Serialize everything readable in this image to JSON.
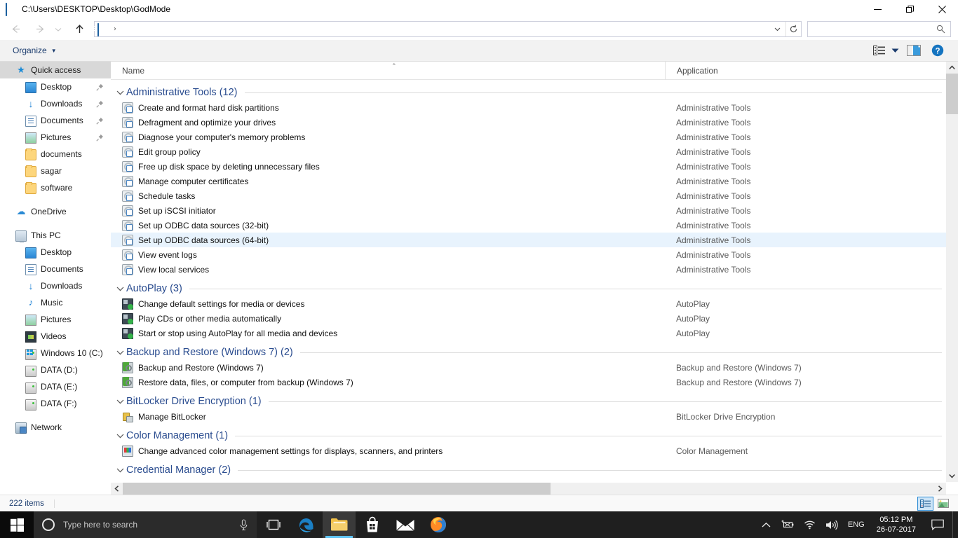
{
  "window": {
    "title": "C:\\Users\\DESKTOP\\Desktop\\GodMode",
    "minimize_label": "Minimize",
    "restore_label": "Restore",
    "close_label": "Close"
  },
  "nav": {
    "back_label": "Back",
    "forward_label": "Forward",
    "recent_label": "Recent locations",
    "up_label": "Up",
    "address_separator": "›",
    "address_chevron": "⌄",
    "refresh_label": "Refresh"
  },
  "search": {
    "placeholder": "",
    "value": "",
    "icon": "search-icon"
  },
  "command_bar": {
    "organize_label": "Organize",
    "organize_caret": "▼",
    "view_caret": "▼",
    "view_label": "Change your view",
    "preview_label": "Show the preview pane",
    "help_label": "Help"
  },
  "sidebar": {
    "items": [
      {
        "label": "Quick access",
        "icon": "star-icon",
        "level": 0,
        "selected": true,
        "pinned": false
      },
      {
        "label": "Desktop",
        "icon": "desktop-icon",
        "level": 1,
        "selected": false,
        "pinned": true
      },
      {
        "label": "Downloads",
        "icon": "download-icon",
        "level": 1,
        "selected": false,
        "pinned": true
      },
      {
        "label": "Documents",
        "icon": "documents-icon",
        "level": 1,
        "selected": false,
        "pinned": true
      },
      {
        "label": "Pictures",
        "icon": "pictures-icon",
        "level": 1,
        "selected": false,
        "pinned": true
      },
      {
        "label": "documents",
        "icon": "folder-icon",
        "level": 1,
        "selected": false,
        "pinned": false
      },
      {
        "label": "sagar",
        "icon": "folder-icon",
        "level": 1,
        "selected": false,
        "pinned": false
      },
      {
        "label": "software",
        "icon": "folder-icon",
        "level": 1,
        "selected": false,
        "pinned": false
      },
      {
        "label": "OneDrive",
        "icon": "onedrive-cloud-icon",
        "level": 0,
        "selected": false,
        "pinned": false,
        "gap_before": true
      },
      {
        "label": "This PC",
        "icon": "this-pc-icon",
        "level": 0,
        "selected": false,
        "pinned": false,
        "gap_before": true
      },
      {
        "label": "Desktop",
        "icon": "desktop-icon",
        "level": 1,
        "selected": false,
        "pinned": false
      },
      {
        "label": "Documents",
        "icon": "documents-icon",
        "level": 1,
        "selected": false,
        "pinned": false
      },
      {
        "label": "Downloads",
        "icon": "download-icon",
        "level": 1,
        "selected": false,
        "pinned": false
      },
      {
        "label": "Music",
        "icon": "music-note-icon",
        "level": 1,
        "selected": false,
        "pinned": false
      },
      {
        "label": "Pictures",
        "icon": "pictures-icon",
        "level": 1,
        "selected": false,
        "pinned": false
      },
      {
        "label": "Videos",
        "icon": "videos-icon",
        "level": 1,
        "selected": false,
        "pinned": false
      },
      {
        "label": "Windows 10 (C:)",
        "icon": "windows-drive-icon",
        "level": 1,
        "selected": false,
        "pinned": false
      },
      {
        "label": "DATA (D:)",
        "icon": "drive-icon",
        "level": 1,
        "selected": false,
        "pinned": false
      },
      {
        "label": "DATA (E:)",
        "icon": "drive-icon",
        "level": 1,
        "selected": false,
        "pinned": false
      },
      {
        "label": "DATA (F:)",
        "icon": "drive-icon",
        "level": 1,
        "selected": false,
        "pinned": false
      },
      {
        "label": "Network",
        "icon": "network-icon",
        "level": 0,
        "selected": false,
        "pinned": false,
        "gap_before": true
      }
    ],
    "pin_glyph": "📌"
  },
  "columns": {
    "name": "Name",
    "application": "Application",
    "sort_arrow": "⌃"
  },
  "groups": [
    {
      "title": "Administrative Tools (12)",
      "chevron": "⌄",
      "icon": "administrative-tools-icon",
      "rows": [
        {
          "name": "Create and format hard disk partitions",
          "app": "Administrative Tools",
          "selected": false
        },
        {
          "name": "Defragment and optimize your drives",
          "app": "Administrative Tools",
          "selected": false
        },
        {
          "name": "Diagnose your computer's memory problems",
          "app": "Administrative Tools",
          "selected": false
        },
        {
          "name": "Edit group policy",
          "app": "Administrative Tools",
          "selected": false
        },
        {
          "name": "Free up disk space by deleting unnecessary files",
          "app": "Administrative Tools",
          "selected": false
        },
        {
          "name": "Manage computer certificates",
          "app": "Administrative Tools",
          "selected": false
        },
        {
          "name": "Schedule tasks",
          "app": "Administrative Tools",
          "selected": false
        },
        {
          "name": "Set up iSCSI initiator",
          "app": "Administrative Tools",
          "selected": false
        },
        {
          "name": "Set up ODBC data sources (32-bit)",
          "app": "Administrative Tools",
          "selected": false
        },
        {
          "name": "Set up ODBC data sources (64-bit)",
          "app": "Administrative Tools",
          "selected": true
        },
        {
          "name": "View event logs",
          "app": "Administrative Tools",
          "selected": false
        },
        {
          "name": "View local services",
          "app": "Administrative Tools",
          "selected": false
        }
      ]
    },
    {
      "title": "AutoPlay (3)",
      "chevron": "⌄",
      "icon": "autoplay-icon",
      "rows": [
        {
          "name": "Change default settings for media or devices",
          "app": "AutoPlay",
          "selected": false
        },
        {
          "name": "Play CDs or other media automatically",
          "app": "AutoPlay",
          "selected": false
        },
        {
          "name": "Start or stop using AutoPlay for all media and devices",
          "app": "AutoPlay",
          "selected": false
        }
      ]
    },
    {
      "title": "Backup and Restore (Windows 7) (2)",
      "chevron": "⌄",
      "icon": "backup-restore-icon",
      "rows": [
        {
          "name": "Backup and Restore (Windows 7)",
          "app": "Backup and Restore (Windows 7)",
          "selected": false
        },
        {
          "name": "Restore data, files, or computer from backup (Windows 7)",
          "app": "Backup and Restore (Windows 7)",
          "selected": false
        }
      ]
    },
    {
      "title": "BitLocker Drive Encryption (1)",
      "chevron": "⌄",
      "icon": "bitlocker-icon",
      "rows": [
        {
          "name": "Manage BitLocker",
          "app": "BitLocker Drive Encryption",
          "selected": false
        }
      ]
    },
    {
      "title": "Color Management (1)",
      "chevron": "⌄",
      "icon": "color-management-icon",
      "rows": [
        {
          "name": "Change advanced color management settings for displays, scanners, and printers",
          "app": "Color Management",
          "selected": false
        }
      ]
    },
    {
      "title": "Credential Manager (2)",
      "chevron": "⌄",
      "icon": "credential-manager-icon",
      "rows": []
    }
  ],
  "status": {
    "count": "222 items",
    "details_view_label": "Details view",
    "large_icons_view_label": "Large icons view"
  },
  "taskbar": {
    "start_label": "Start",
    "search_placeholder": "Type here to search",
    "mic_label": "Talk to Cortana",
    "buttons": [
      {
        "name": "task-view-button",
        "label": "Task View",
        "active": false
      },
      {
        "name": "taskbar-edge-button",
        "label": "Microsoft Edge",
        "active": false
      },
      {
        "name": "taskbar-file-explorer-button",
        "label": "File Explorer",
        "active": true
      },
      {
        "name": "taskbar-store-button",
        "label": "Microsoft Store",
        "active": false
      },
      {
        "name": "taskbar-mail-button",
        "label": "Mail",
        "active": false
      },
      {
        "name": "taskbar-firefox-button",
        "label": "Mozilla Firefox",
        "active": false
      }
    ],
    "tray": {
      "chevron": "⌃",
      "battery_label": "Battery",
      "wifi_label": "Network",
      "volume_label": "Speakers",
      "language": "ENG",
      "time": "05:12 PM",
      "date": "26-07-2017",
      "action_center_label": "Action Center"
    }
  },
  "colors": {
    "accent": "#2a8ad4",
    "group_header": "#2a4c8f",
    "selection": "#e8f3fd",
    "taskbar": "#1f1f1f",
    "link": "#1b3c6e"
  }
}
